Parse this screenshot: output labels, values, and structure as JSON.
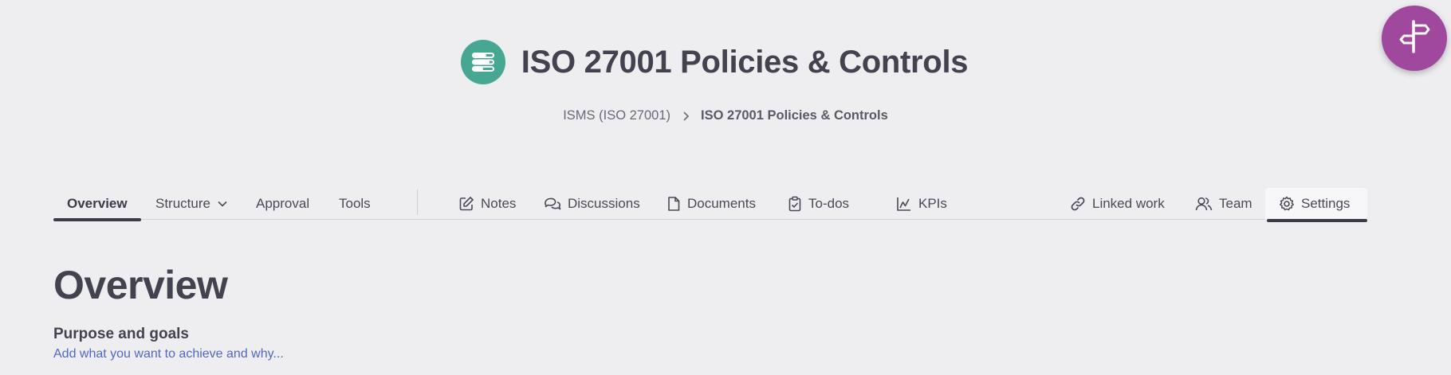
{
  "header": {
    "title": "ISO 27001 Policies & Controls",
    "icon": "list-icon",
    "icon_color": "#46a893"
  },
  "breadcrumb": {
    "parent": "ISMS (ISO 27001)",
    "current": "ISO 27001 Policies & Controls"
  },
  "tabs": {
    "overview": "Overview",
    "structure": "Structure",
    "approval": "Approval",
    "tools": "Tools",
    "notes": "Notes",
    "discussions": "Discussions",
    "documents": "Documents",
    "todos": "To-dos",
    "kpis": "KPIs",
    "linked_work": "Linked work",
    "team": "Team",
    "settings": "Settings"
  },
  "overview": {
    "heading": "Overview",
    "purpose_heading": "Purpose and goals",
    "purpose_placeholder": "Add what you want to achieve and why..."
  },
  "fab": {
    "icon": "signpost-icon",
    "color": "#a0479e"
  },
  "colors": {
    "background": "#eeeef0",
    "text": "#43424f",
    "link": "#4f68c4"
  }
}
